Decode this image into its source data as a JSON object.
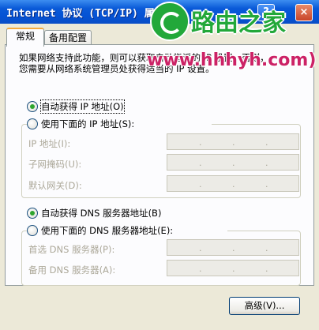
{
  "window": {
    "title": "Internet 协议 (TCP/IP) 属性",
    "help_glyph": "?",
    "close_glyph": "×"
  },
  "watermark": {
    "title": "路由之家",
    "url": "www.hhhyh.com)"
  },
  "tabs": [
    {
      "label": "常规",
      "active": true
    },
    {
      "label": "备用配置",
      "active": false
    }
  ],
  "description": {
    "line1": "如果网络支持此功能，则可以获取自动指派的 IP 设置。否则，",
    "line2": "您需要从网络系统管理员处获得适当的 IP 设置。"
  },
  "ip_section": {
    "auto_label": "自动获得 IP 地址(O)",
    "manual_label": "使用下面的 IP 地址(S):",
    "auto_checked": true,
    "fields": [
      {
        "label": "IP 地址(I):"
      },
      {
        "label": "子网掩码(U):"
      },
      {
        "label": "默认网关(D):"
      }
    ]
  },
  "dns_section": {
    "auto_label": "自动获得 DNS 服务器地址(B)",
    "manual_label": "使用下面的 DNS 服务器地址(E):",
    "auto_checked": true,
    "fields": [
      {
        "label": "首选 DNS 服务器(P):"
      },
      {
        "label": "备用 DNS 服务器(A):"
      }
    ]
  },
  "advanced_button": "高级(V)...",
  "colors": {
    "titlebar": "#0a5ad8",
    "watermark_green": "#22a83a",
    "watermark_url": "#cc2266",
    "radio_checked": "#2fa52f",
    "disabled_text": "#aca899"
  }
}
